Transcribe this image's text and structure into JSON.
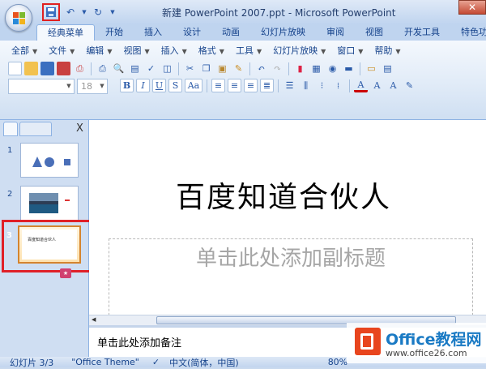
{
  "window": {
    "title": "新建 PowerPoint 2007.ppt - Microsoft PowerPoint",
    "close_glyph": "✕"
  },
  "colors": {
    "highlight": "#e02020",
    "ribbon_bg": "#dfeaf7",
    "accent": "#15428b"
  },
  "tabs": [
    {
      "label": "经典菜单",
      "active": true
    },
    {
      "label": "开始"
    },
    {
      "label": "插入"
    },
    {
      "label": "设计"
    },
    {
      "label": "动画"
    },
    {
      "label": "幻灯片放映"
    },
    {
      "label": "审阅"
    },
    {
      "label": "视图"
    },
    {
      "label": "开发工具"
    },
    {
      "label": "特色功能"
    }
  ],
  "menus": [
    "全部",
    "文件",
    "编辑",
    "视图",
    "插入",
    "格式",
    "工具",
    "幻灯片放映",
    "窗口",
    "帮助"
  ],
  "format_bar": {
    "font_size": "18"
  },
  "slides_pane": {
    "close": "X",
    "slides": [
      {
        "num": "1"
      },
      {
        "num": "2"
      },
      {
        "num": "3",
        "title": "百度知道合伙人"
      }
    ]
  },
  "slide": {
    "title": "百度知道合伙人",
    "subtitle_placeholder": "单击此处添加副标题"
  },
  "notes": {
    "placeholder": "单击此处添加备注"
  },
  "status": {
    "slide": "幻灯片 3/3",
    "theme": "\"Office Theme\"",
    "language": "中文(简体，中国)",
    "zoom": "80%"
  },
  "brand": {
    "name": "Office教程网",
    "url": "www.office26.com"
  }
}
